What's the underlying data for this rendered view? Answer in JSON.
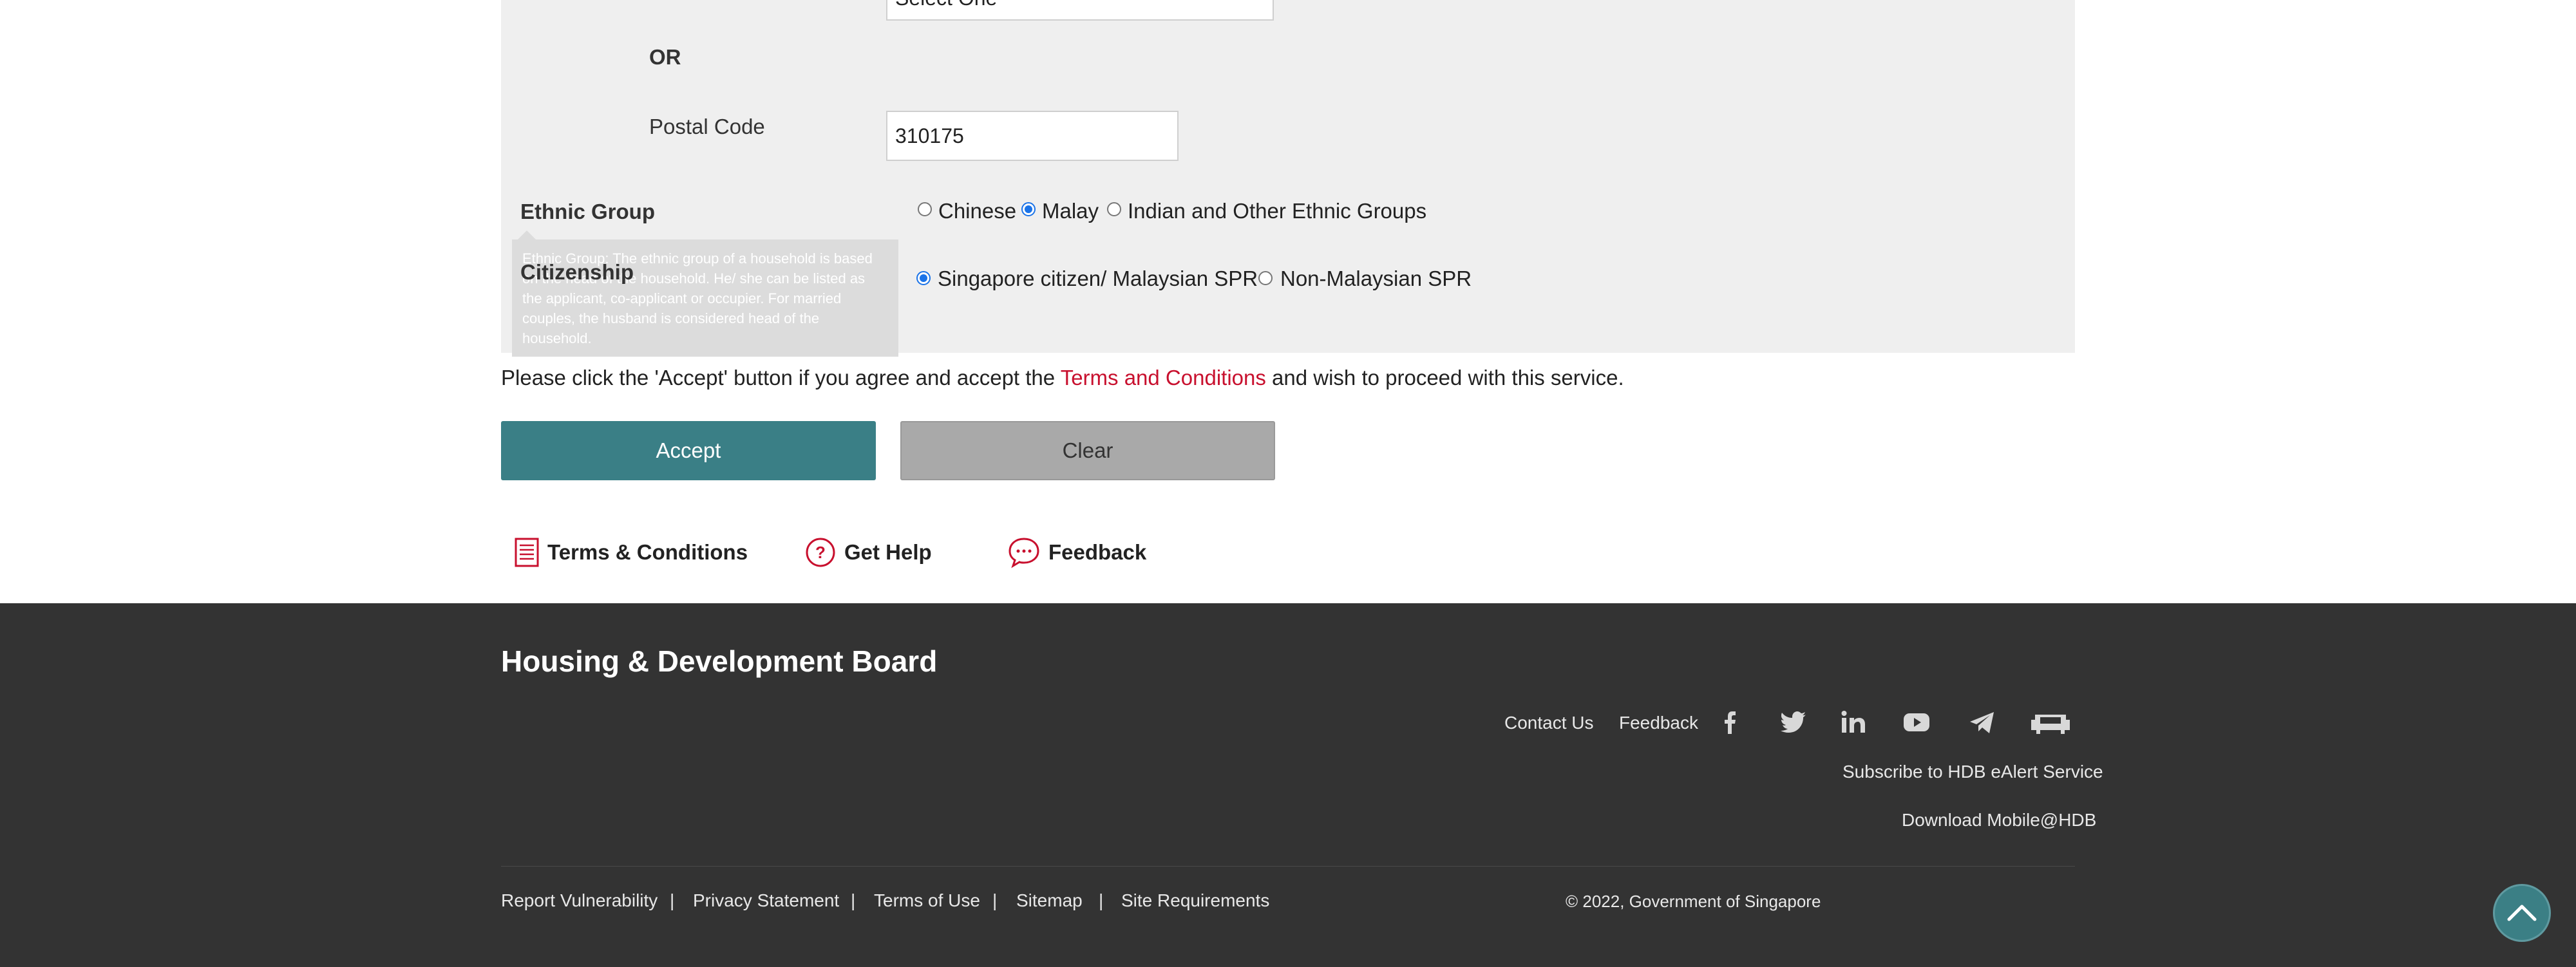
{
  "form": {
    "select_value": "Select One",
    "or_label": "OR",
    "postal_label": "Postal Code",
    "postal_value": "310175",
    "ethnic_label": "Ethnic Group",
    "ethnic_options": [
      "Chinese",
      "Malay",
      "Indian and Other Ethnic Groups"
    ],
    "ethnic_selected": "Malay",
    "citizenship_label": "Citizenship",
    "citizenship_options": [
      "Singapore citizen/ Malaysian SPR",
      "Non-Malaysian SPR"
    ],
    "citizenship_selected": "Singapore citizen/ Malaysian SPR",
    "tooltip_text": "Ethnic Group: The ethnic group of a household is based on the head of the household. He/ she can be listed as the applicant, co-applicant or occupier. For married couples, the husband is considered head of the household."
  },
  "notice": {
    "before": "Please click the 'Accept' button if you agree and accept the ",
    "link": "Terms and Conditions",
    "after": " and wish to proceed with this service."
  },
  "buttons": {
    "accept": "Accept",
    "clear": "Clear"
  },
  "quick_links": {
    "terms": "Terms & Conditions",
    "help": "Get Help",
    "feedback": "Feedback"
  },
  "footer": {
    "title": "Housing & Development Board",
    "contact": "Contact Us",
    "feedback": "Feedback",
    "social_icons": [
      "facebook-icon",
      "twitter-icon",
      "linkedin-icon",
      "youtube-icon",
      "telegram-icon",
      "hdb-sofa-icon"
    ],
    "subscribe": "Subscribe to HDB eAlert Service",
    "download": "Download Mobile@HDB",
    "bottom_links": [
      "Report Vulnerability",
      "Privacy Statement",
      "Terms of Use",
      "Sitemap",
      "Site Requirements"
    ],
    "separator": "|",
    "copyright": "© 2022, Government of Singapore"
  },
  "colors": {
    "accent_teal": "#3a7f86",
    "link_red": "#c8102e",
    "footer_bg": "#333333",
    "panel_bg": "#efefef"
  }
}
